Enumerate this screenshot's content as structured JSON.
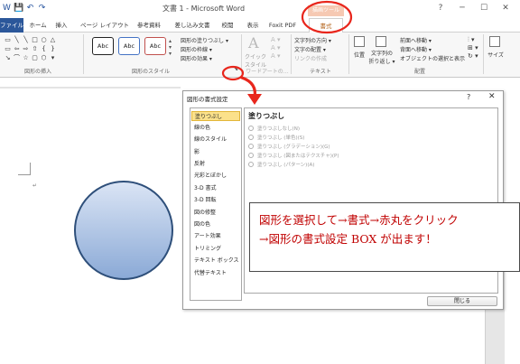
{
  "window": {
    "title": "文書 1 - Microsoft Word",
    "controls": [
      "?",
      "─",
      "☐",
      "✕"
    ]
  },
  "qat": [
    "W",
    "💾",
    "↶",
    "↷"
  ],
  "tabs": {
    "file": "ファイル",
    "home": "ホーム",
    "insert": "挿入",
    "layout": "ページ レイアウト",
    "references": "参考資料",
    "mailings": "差し込み文書",
    "review": "校閲",
    "view": "表示",
    "foxit": "Foxit PDF",
    "format": "書式",
    "contextual": "描画ツール"
  },
  "ribbon": {
    "insert_shapes_label": "図形の挿入",
    "shape_styles_label": "図形のスタイル",
    "style_sample": "Abc",
    "fill_menu": "図形の塗りつぶし ▾",
    "outline_menu": "図形の枠線 ▾",
    "effects_menu": "図形の効果 ▾",
    "quick_styles": "クイック\nスタイル",
    "wordart_label": "ワードアートの…",
    "text_direction": "文字列の方向 ▾",
    "text_align": "文字の配置 ▾",
    "create_link": "リンクの作成",
    "text_label": "テキスト",
    "position": "位置",
    "wrap_text": "文字列の\n折り返し ▾",
    "bring_forward": "前面へ移動 ▾",
    "send_backward": "背面へ移動 ▾",
    "selection_pane": "オブジェクトの選択と表示",
    "arrange_label": "配置",
    "size": "サイズ"
  },
  "dialog": {
    "title": "図形の書式設定",
    "help": "?",
    "close_x": "✕",
    "nav": [
      "塗りつぶし",
      "線の色",
      "線のスタイル",
      "影",
      "反射",
      "光彩とぼかし",
      "3-D 書式",
      "3-D 回転",
      "図の修整",
      "図の色",
      "アート効果",
      "トリミング",
      "テキスト ボックス",
      "代替テキスト"
    ],
    "pane_heading": "塗りつぶし",
    "options": [
      "塗りつぶしなし(N)",
      "塗りつぶし (単色)(S)",
      "塗りつぶし (グラデーション)(G)",
      "塗りつぶし (図またはテクスチャ)(P)",
      "塗りつぶし (パターン)(A)"
    ],
    "close_button": "閉じる"
  },
  "callout": {
    "line1": "図形を選択して→書式→赤丸をクリック",
    "line2": "→図形の書式設定 BOX が出ます！"
  },
  "colors": {
    "file_tab": "#2b579a",
    "contextual_tab": "#f6c9b3",
    "highlight": "#e8261c",
    "circle_fill_top": "#dbe5f5",
    "circle_fill_bottom": "#8aa9d6",
    "circle_stroke": "#2e4f7a",
    "callout_text": "#c00000",
    "nav_selected": "#fbe18b"
  }
}
